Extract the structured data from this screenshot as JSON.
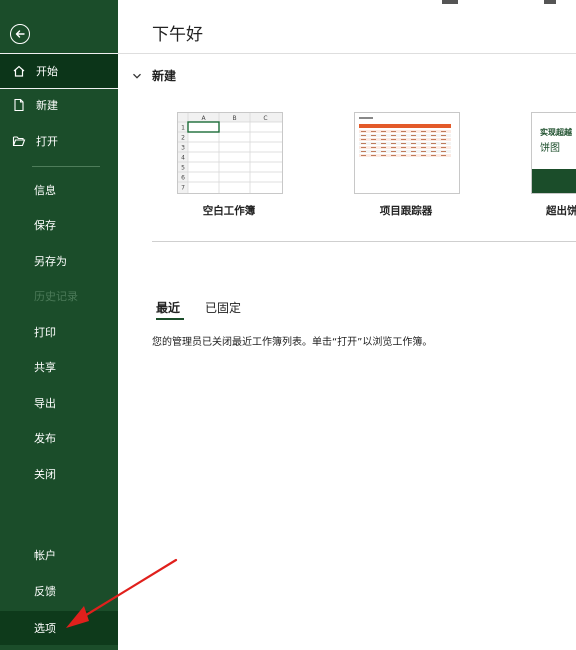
{
  "sidebar": {
    "back_icon": "back-arrow-icon",
    "items": [
      {
        "label": "开始",
        "icon": "home-icon",
        "state": "active"
      },
      {
        "label": "新建",
        "icon": "new-document-icon",
        "state": "normal"
      },
      {
        "label": "打开",
        "icon": "open-folder-icon",
        "state": "normal"
      },
      {
        "label": "信息",
        "state": "normal"
      },
      {
        "label": "保存",
        "state": "normal"
      },
      {
        "label": "另存为",
        "state": "normal"
      },
      {
        "label": "历史记录",
        "state": "disabled"
      },
      {
        "label": "打印",
        "state": "normal"
      },
      {
        "label": "共享",
        "state": "normal"
      },
      {
        "label": "导出",
        "state": "normal"
      },
      {
        "label": "发布",
        "state": "normal"
      },
      {
        "label": "关闭",
        "state": "normal"
      },
      {
        "label": "帐户",
        "state": "normal"
      },
      {
        "label": "反馈",
        "state": "normal"
      },
      {
        "label": "选项",
        "state": "selected"
      }
    ]
  },
  "main": {
    "greeting": "下午好",
    "new_section": {
      "title": "新建",
      "templates": [
        {
          "label": "空白工作簿"
        },
        {
          "label": "项目跟踪器"
        },
        {
          "label": "超出饼",
          "thumb_title": "实现超越",
          "thumb_subtitle": "饼图"
        }
      ]
    },
    "tabs": [
      "最近",
      "已固定"
    ],
    "recent_message": "您的管理员已关闭最近工作簿列表。单击“打开”以浏览工作簿。"
  },
  "spreadsheet_thumb": {
    "columns": [
      "A",
      "B",
      "C"
    ],
    "rows": [
      "1",
      "2",
      "3",
      "4",
      "5",
      "6",
      "7"
    ]
  },
  "colors": {
    "sidebar_bg": "#1b4d2a",
    "accent": "#1b4d2a",
    "annotation_arrow": "#e0201c",
    "tracker_header": "#e35a2a"
  }
}
